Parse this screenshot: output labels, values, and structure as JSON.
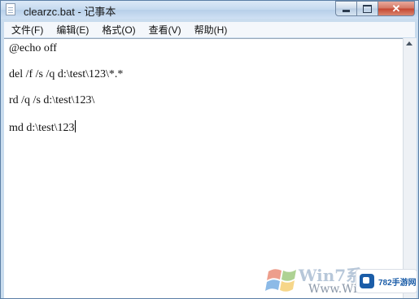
{
  "window": {
    "title": "clearzc.bat - 记事本",
    "controls": {
      "minimize": "",
      "maximize": "",
      "close": "✕"
    }
  },
  "menu": [
    "文件(F)",
    "编辑(E)",
    "格式(O)",
    "查看(V)",
    "帮助(H)"
  ],
  "editor": {
    "lines": [
      "@echo off",
      "del /f /s /q d:\\test\\123\\*.*",
      "rd /q /s d:\\test\\123\\",
      "md d:\\test\\123"
    ]
  },
  "watermark": {
    "logo_text": "Win7系",
    "sub_text": "Www.Win7",
    "badge_text": "782手游网"
  },
  "colors": {
    "titlebar": "#c4d9ef",
    "close_button": "#c5452f",
    "badge_blue": "#1b5da8"
  }
}
